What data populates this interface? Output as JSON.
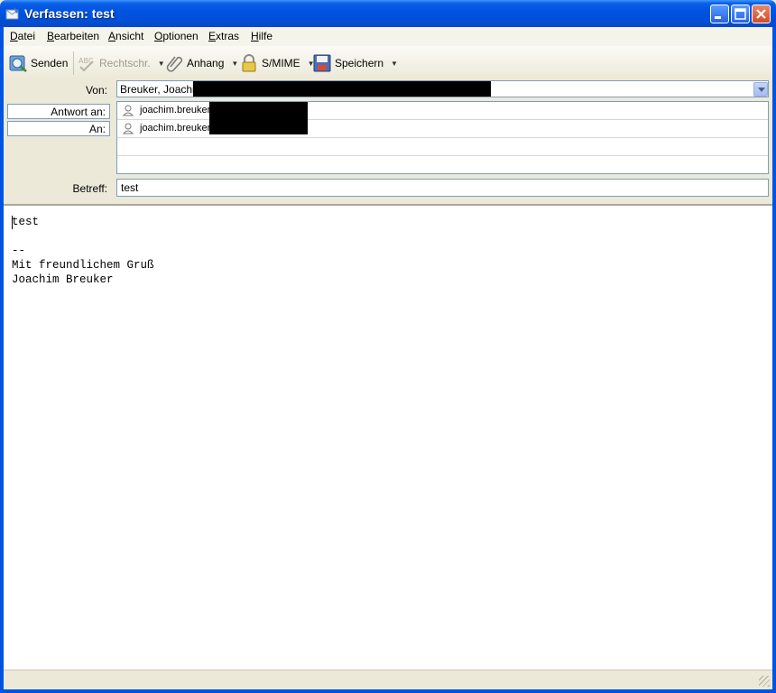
{
  "window": {
    "title": "Verfassen: test"
  },
  "menu": [
    "Datei",
    "Bearbeiten",
    "Ansicht",
    "Optionen",
    "Extras",
    "Hilfe"
  ],
  "toolbar": {
    "send_label": "Senden",
    "spell_label": "Rechtschr.",
    "attach_label": "Anhang",
    "smime_label": "S/MIME",
    "save_label": "Speichern"
  },
  "header": {
    "from_label": "Von:",
    "from_value": "Breuker, Joachim",
    "subject_label": "Betreff:",
    "subject_value": "test",
    "recipients": [
      {
        "type": "Antwort an:",
        "address": "joachim.breuker"
      },
      {
        "type": "An:",
        "address": "joachim.breuker"
      }
    ]
  },
  "body": {
    "text": "test\n\n--\nMit freundlichem Gruß\nJoachim Breuker"
  }
}
